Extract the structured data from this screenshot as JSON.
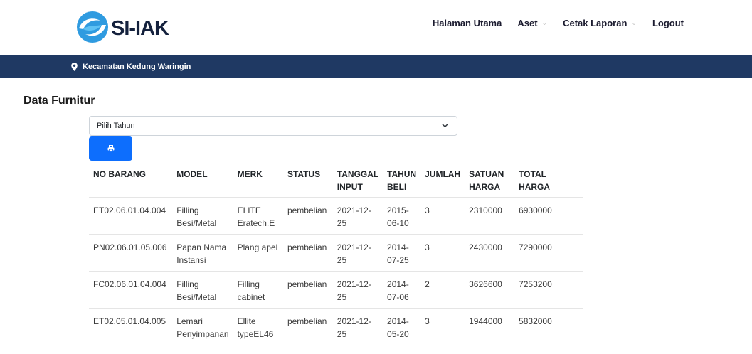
{
  "brand": {
    "name": "SI-IAK"
  },
  "nav": {
    "items": [
      {
        "label": "Halaman Utama",
        "dropdown": false
      },
      {
        "label": "Aset",
        "dropdown": true
      },
      {
        "label": "Cetak Laporan",
        "dropdown": true
      },
      {
        "label": "Logout",
        "dropdown": false
      }
    ]
  },
  "topbar": {
    "location": "Kecamatan Kedung Waringin",
    "icon": "map-pin-icon"
  },
  "page": {
    "title": "Data Furnitur"
  },
  "filter": {
    "select_value": "Pilih Tahun",
    "print_icon": "printer-icon"
  },
  "table": {
    "headers": [
      "NO BARANG",
      "MODEL",
      "MERK",
      "STATUS",
      "TANGGAL INPUT",
      "TAHUN BELI",
      "JUMLAH",
      "SATUAN HARGA",
      "TOTAL HARGA"
    ],
    "rows": [
      [
        "ET02.06.01.04.004",
        "Filling Besi/Metal",
        "ELITE Eratech.E",
        "pembelian",
        "2021-12-25",
        "2015-06-10",
        "3",
        "2310000",
        "6930000"
      ],
      [
        "PN02.06.01.05.006",
        "Papan Nama Instansi",
        "Plang apel",
        "pembelian",
        "2021-12-25",
        "2014-07-25",
        "3",
        "2430000",
        "7290000"
      ],
      [
        "FC02.06.01.04.004",
        "Filling Besi/Metal",
        "Filling cabinet",
        "pembelian",
        "2021-12-25",
        "2014-07-06",
        "2",
        "3626600",
        "7253200"
      ],
      [
        "ET02.05.01.04.005",
        "Lemari Penyimpanan",
        "Ellite typeEL46",
        "pembelian",
        "2021-12-25",
        "2014-05-20",
        "3",
        "1944000",
        "5832000"
      ]
    ]
  },
  "colors": {
    "navy": "#1f3963",
    "primary": "#0d6efd",
    "logo_blue": "#2f9be0",
    "logo_dark": "#14213d"
  }
}
